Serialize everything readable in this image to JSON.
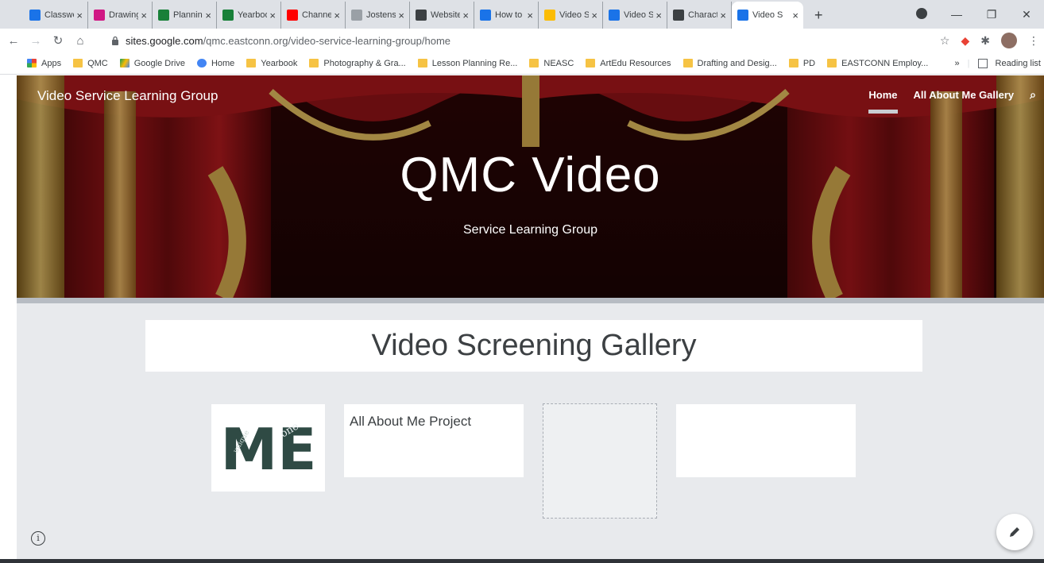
{
  "browser": {
    "tabs": [
      {
        "title": "Classwo",
        "icon": "classroom-icon",
        "color": "#1a73e8"
      },
      {
        "title": "Drawing",
        "icon": "classroom-icon",
        "color": "#d01884"
      },
      {
        "title": "Plannin",
        "icon": "sheets-icon",
        "color": "#188038"
      },
      {
        "title": "Yearboo",
        "icon": "classroom-icon",
        "color": "#188038"
      },
      {
        "title": "Channe",
        "icon": "youtube-icon",
        "color": "#ff0000"
      },
      {
        "title": "Jostens",
        "icon": "jostens-icon",
        "color": "#9aa0a6"
      },
      {
        "title": "Website",
        "icon": "classroom-icon",
        "color": "#3c4043"
      },
      {
        "title": "How to",
        "icon": "sites-icon",
        "color": "#1a73e8"
      },
      {
        "title": "Video S",
        "icon": "drive-icon",
        "color": "#fbbc04"
      },
      {
        "title": "Video S",
        "icon": "sites-icon",
        "color": "#1a73e8"
      },
      {
        "title": "Charact",
        "icon": "character-icon",
        "color": "#3c4043"
      },
      {
        "title": "Video S",
        "icon": "sites-icon",
        "color": "#1a73e8",
        "active": true
      }
    ],
    "url_domain": "sites.google.com",
    "url_path": "/qmc.eastconn.org/video-service-learning-group/home",
    "bookmarks": [
      "Apps",
      "QMC",
      "Google Drive",
      "Home",
      "Yearbook",
      "Photography & Gra...",
      "Lesson Planning Re...",
      "NEASC",
      "ArtEdu Resources",
      "Drafting and Desig...",
      "PD",
      "EASTCONN Employ..."
    ],
    "bookmarks_overflow": "»",
    "reading_list": "Reading list"
  },
  "site": {
    "title": "Video Service Learning Group",
    "nav": [
      {
        "label": "Home",
        "active": true
      },
      {
        "label": "All About Me Gallery"
      }
    ],
    "hero_title": "QMC Video",
    "hero_subtitle": "Service Learning Group",
    "gallery_heading": "Video Screening Gallery",
    "card_title": "All About Me Project",
    "me_image_text": "ME",
    "me_image_sub1": "one",
    "me_image_sub2": "unique"
  }
}
